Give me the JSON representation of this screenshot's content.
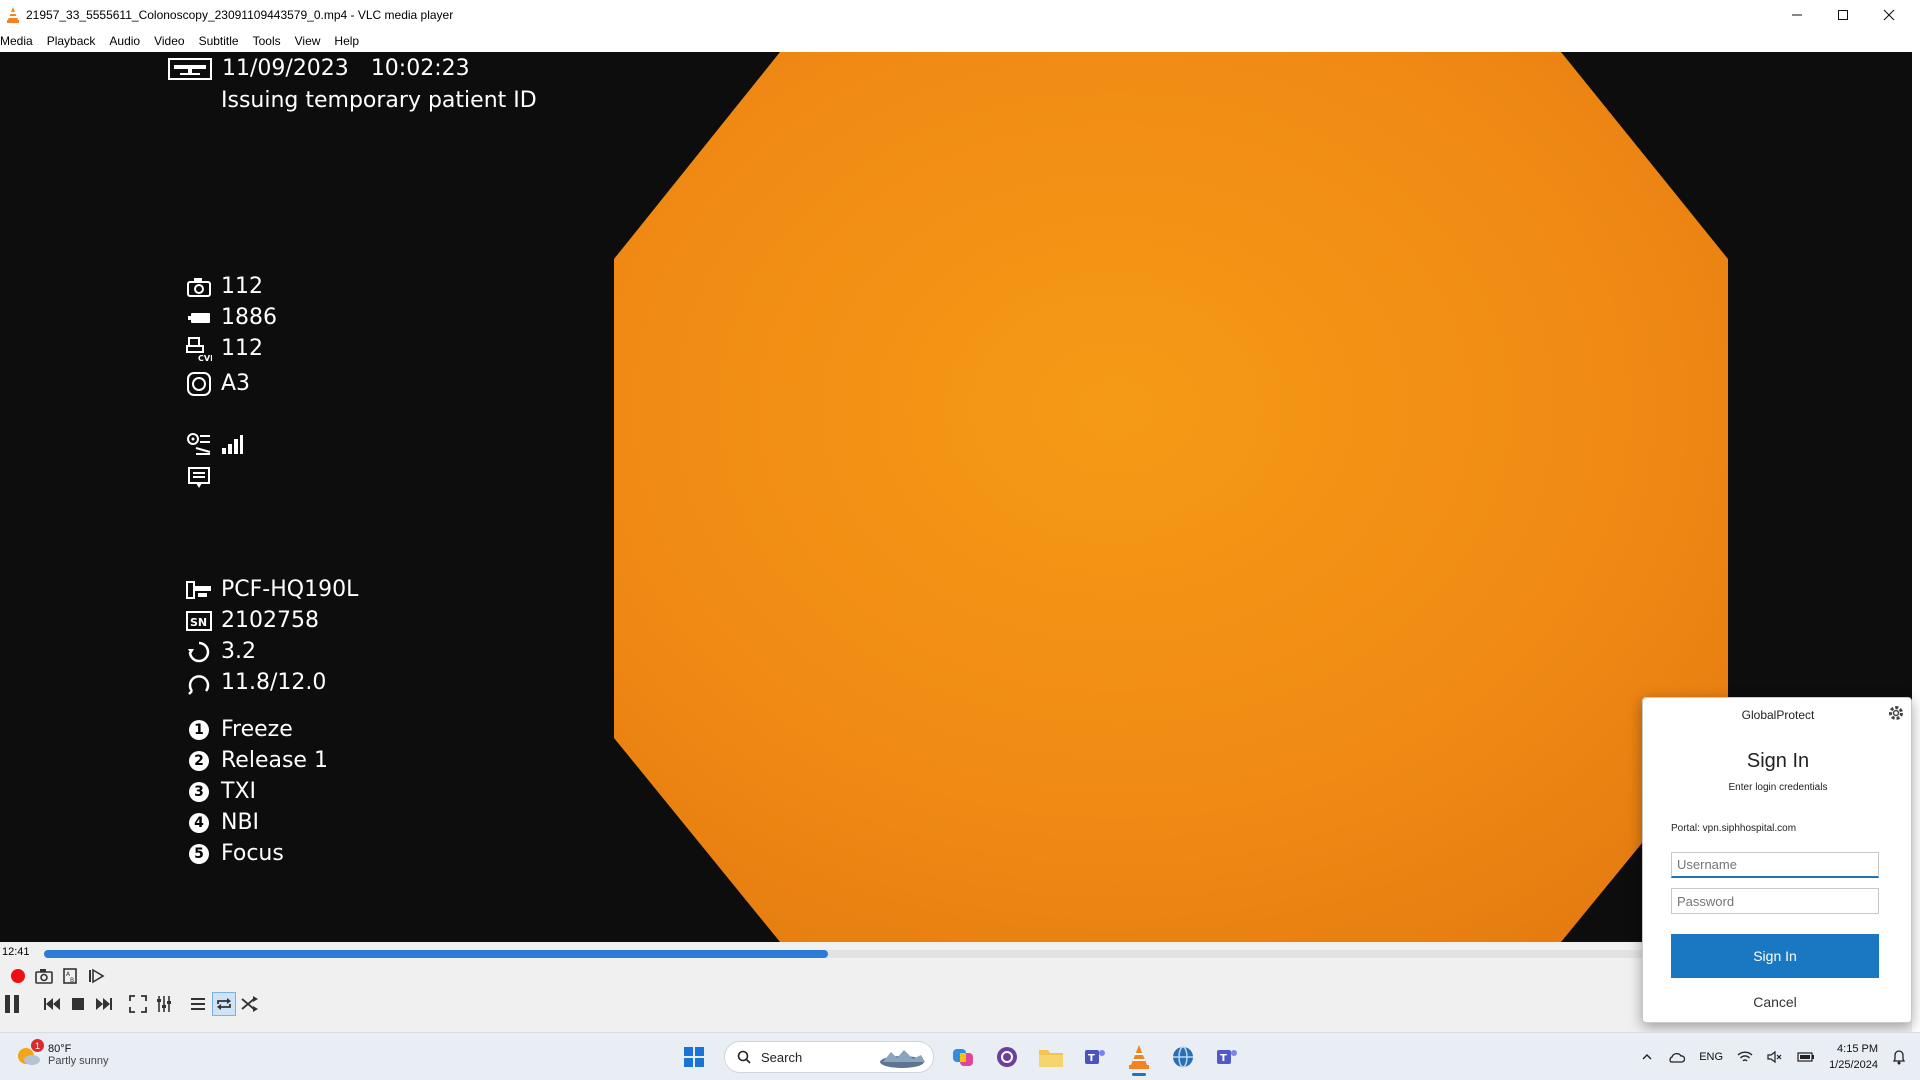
{
  "window": {
    "title": "21957_33_5555611_Colonoscopy_23091109443579_0.mp4 - VLC media player",
    "controls": [
      "minimize-icon",
      "maximize-icon",
      "close-icon"
    ]
  },
  "menu": [
    "Media",
    "Playback",
    "Audio",
    "Video",
    "Subtitle",
    "Tools",
    "View",
    "Help"
  ],
  "osd": {
    "date": "11/09/2023",
    "time": "10:02:23",
    "status": "Issuing temporary patient ID",
    "camera_count": "112",
    "battery_value": "1886",
    "cvp_value": "112",
    "mode": "A3",
    "scope_model": "PCF-HQ190L",
    "serial": "2102758",
    "value_a": "3.2",
    "value_b": "11.8/12.0",
    "functions": [
      {
        "num": "1",
        "label": "Freeze"
      },
      {
        "num": "2",
        "label": "Release 1"
      },
      {
        "num": "3",
        "label": "TXI"
      },
      {
        "num": "4",
        "label": "NBI"
      },
      {
        "num": "5",
        "label": "Focus"
      }
    ]
  },
  "player": {
    "elapsed": "12:41",
    "progress": 0.49
  },
  "taskbar": {
    "weather_temp": "80°F",
    "weather_desc": "Partly sunny",
    "weather_badge": "1",
    "search_label": "Search",
    "tray_lang": "ENG",
    "clock_time": "4:15 PM",
    "clock_date": "1/25/2024"
  },
  "globalprotect": {
    "title": "GlobalProtect",
    "heading": "Sign In",
    "subheading": "Enter login credentials",
    "portal": "Portal: vpn.siphhospital.com",
    "username_placeholder": "Username",
    "password_placeholder": "Password",
    "signin_label": "Sign In",
    "cancel_label": "Cancel"
  },
  "colors": {
    "accent": "#1a77c2",
    "seek_fill": "#2c7bd6",
    "endoscope_orange": "#f08a14"
  }
}
